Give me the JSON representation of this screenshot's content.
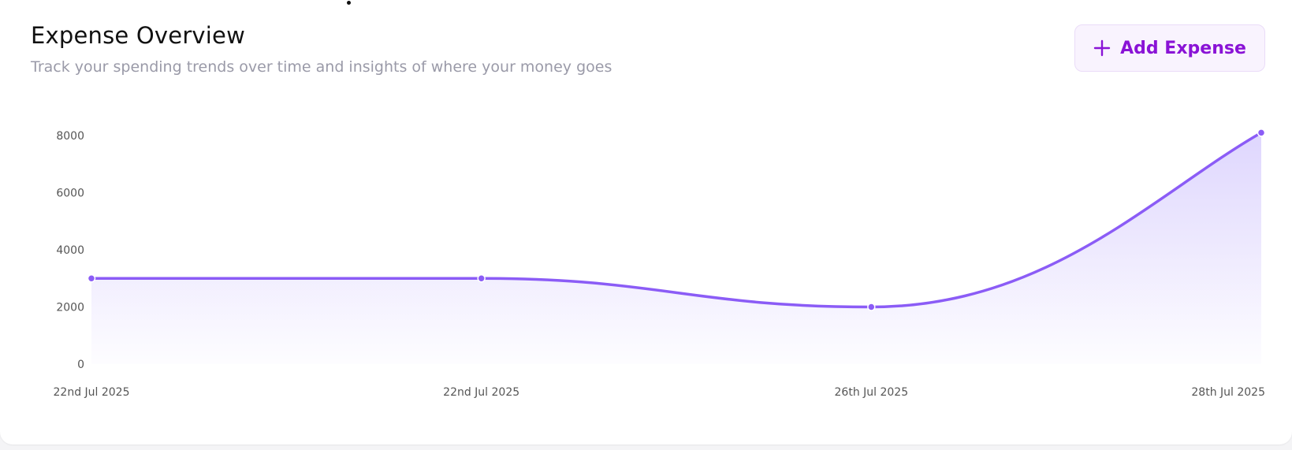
{
  "header": {
    "title": "Expense Overview",
    "subtitle": "Track your spending trends over time and insights of where your money goes"
  },
  "add_button": {
    "label": "Add Expense",
    "icon": "plus-icon",
    "color": "#8a13d6"
  },
  "colors": {
    "line": "#8b5cf6",
    "fill": "#c4b5fd"
  },
  "chart_data": {
    "type": "area",
    "x": [
      "22nd Jul 2025",
      "22nd Jul 2025",
      "26th Jul 2025",
      "28th Jul 2025"
    ],
    "series": [
      {
        "values": [
          3000,
          3000,
          2000,
          8100
        ]
      }
    ],
    "y_ticks": [
      0,
      2000,
      4000,
      6000,
      8000
    ],
    "ylim": [
      0,
      8000
    ],
    "grid": false,
    "legend": "none",
    "curve": "smooth"
  }
}
